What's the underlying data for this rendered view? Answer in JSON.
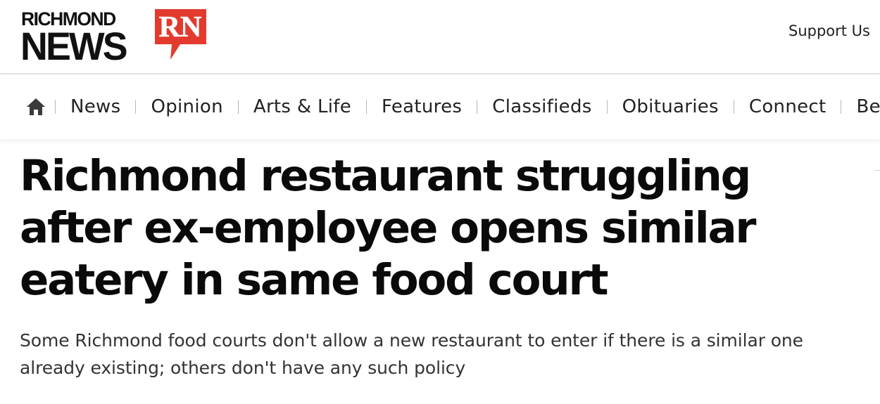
{
  "header": {
    "logo": {
      "line1": "RICHMOND",
      "line2": "NEWS",
      "badge_text": "RN",
      "badge_color": "#e23b2e"
    },
    "support_link": "Support Us"
  },
  "nav": {
    "home_icon": "home-icon",
    "items": [
      {
        "label": "News"
      },
      {
        "label": "Opinion"
      },
      {
        "label": "Arts & Life"
      },
      {
        "label": "Features"
      },
      {
        "label": "Classifieds"
      },
      {
        "label": "Obituaries"
      },
      {
        "label": "Connect"
      },
      {
        "label": "Best of"
      }
    ]
  },
  "article": {
    "headline": "Richmond restaurant struggling after ex-employee opens similar eatery in same food court",
    "deck": "Some Richmond food courts don't allow a new restaurant to enter if there is a similar one already existing; others don't have any such policy"
  }
}
